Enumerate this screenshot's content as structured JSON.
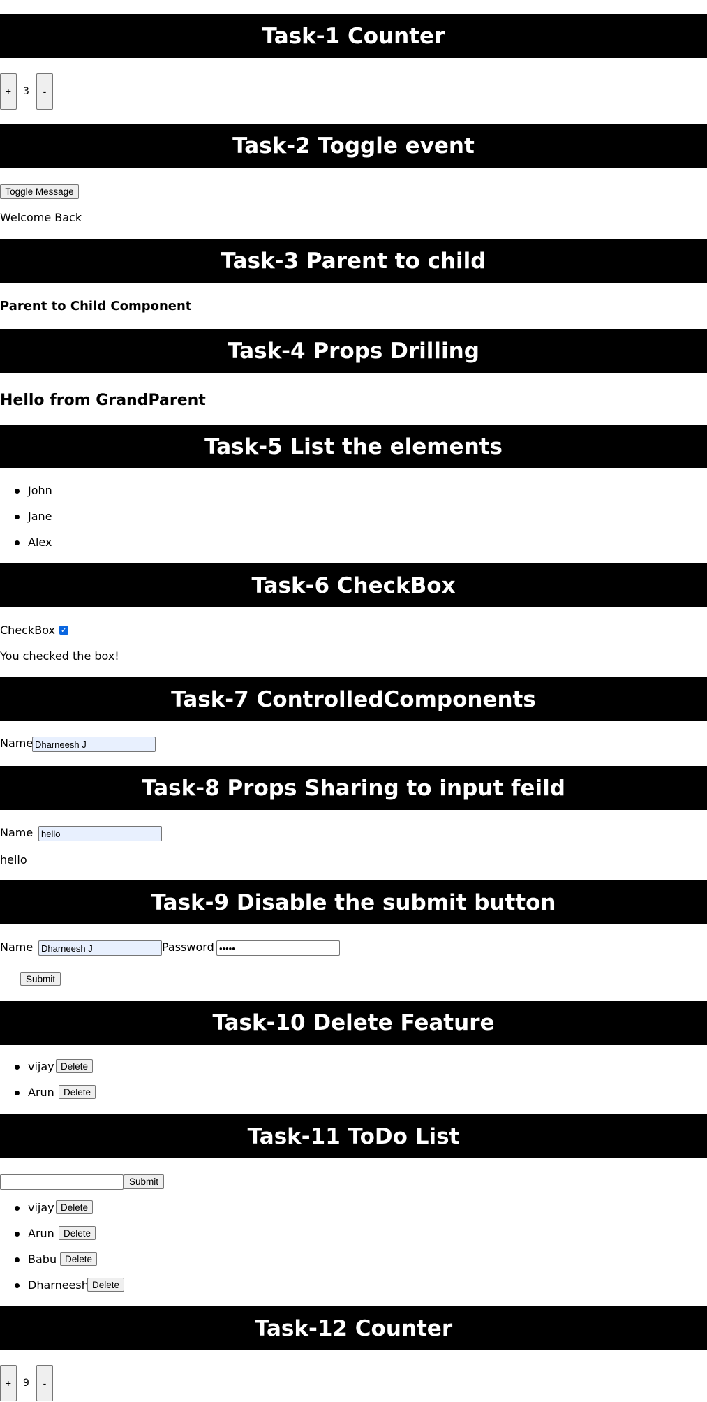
{
  "tasks": {
    "t1": {
      "title": "Task-1 Counter",
      "plus": "+",
      "minus": "-",
      "count": "3"
    },
    "t2": {
      "title": "Task-2 Toggle event",
      "button": "Toggle Message",
      "message": "Welcome Back"
    },
    "t3": {
      "title": "Task-3 Parent to child",
      "text": "Parent to Child Component"
    },
    "t4": {
      "title": "Task-4 Props Drilling",
      "text": "Hello from GrandParent"
    },
    "t5": {
      "title": "Task-5 List the elements",
      "items": [
        "John",
        "Jane",
        "Alex"
      ]
    },
    "t6": {
      "title": "Task-6 CheckBox",
      "label": "CheckBox :",
      "checked": true,
      "message": "You checked the box!"
    },
    "t7": {
      "title": "Task-7 ControlledComponents",
      "label": "Name:",
      "value": "Dharneesh J"
    },
    "t8": {
      "title": "Task-8 Props Sharing to input feild",
      "label": "Name :",
      "value": "hello",
      "output": "hello"
    },
    "t9": {
      "title": "Task-9 Disable the submit button",
      "name_label": "Name :",
      "name_value": "Dharneesh J",
      "password_label": "Password :",
      "password_value": "•••••",
      "submit": "Submit"
    },
    "t10": {
      "title": "Task-10 Delete Feature",
      "items": [
        "vijay",
        "Arun"
      ],
      "delete": "Delete"
    },
    "t11": {
      "title": "Task-11 ToDo List",
      "input_value": "",
      "submit": "Submit",
      "items": [
        "vijay",
        "Arun",
        "Babu",
        "Dharneesh"
      ],
      "delete": "Delete"
    },
    "t12": {
      "title": "Task-12 Counter",
      "plus": "+",
      "minus": "-",
      "count": "9"
    }
  },
  "colors": {
    "header_bg": "#000000",
    "header_text": "#ffffff",
    "autofill_bg": "#e8f0fe",
    "checkbox": "#0a66e0"
  }
}
